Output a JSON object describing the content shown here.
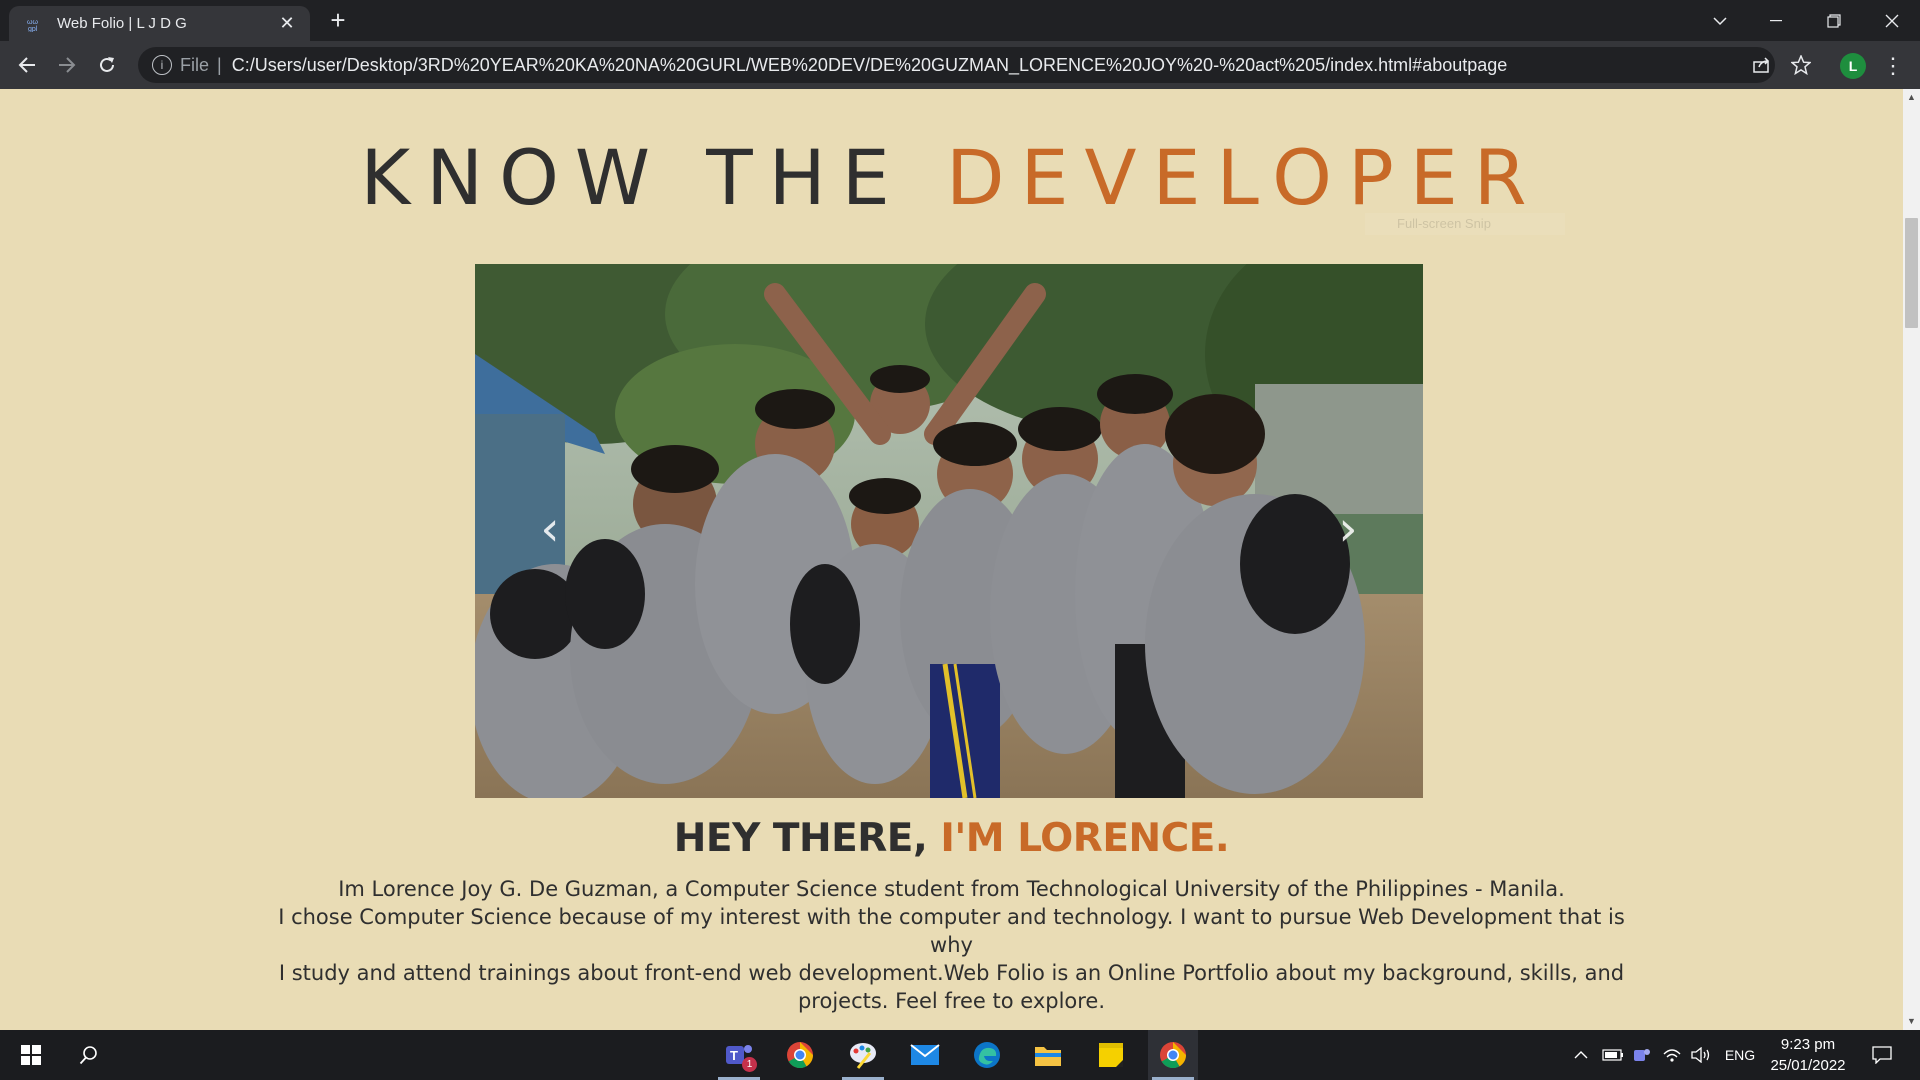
{
  "browser": {
    "tab_title": "Web Folio | L J D G",
    "tab_close": "✕",
    "new_tab": "+",
    "address_scheme": "File",
    "address_url": "C:/Users/user/Desktop/3RD%20YEAR%20KA%20NA%20GURL/WEB%20DEV/DE%20GUZMAN_LORENCE%20JOY%20-%20act%205/index.html#aboutpage",
    "profile_initial": "L"
  },
  "page": {
    "heading_dark": "KNOW THE ",
    "heading_accent": "DEVELOPER",
    "snip_hint": "Full-screen Snip",
    "greeting_dark": "HEY THERE, ",
    "greeting_accent": "I'M LORENCE.",
    "bio_lines": [
      "Im Lorence Joy G. De Guzman, a Computer Science student from Technological University of the Philippines - Manila.",
      "I chose Computer Science because of my interest with the computer and technology. I want to pursue Web Development that is why",
      "I study and attend trainings about front-end web development.Web Folio is an Online Portfolio about my background, skills, and",
      "projects. Feel free to explore."
    ],
    "carousel_prev": "‹",
    "carousel_next": "›",
    "carousel_slide_count": 4,
    "carousel_active_index": 1,
    "colors": {
      "background": "#e9dcb5",
      "accent": "#c86a28",
      "text": "#2f2f2f"
    }
  },
  "taskbar": {
    "teams_badge": "1",
    "tray_language": "ENG",
    "clock_time": "9:23 pm",
    "clock_date": "25/01/2022"
  }
}
